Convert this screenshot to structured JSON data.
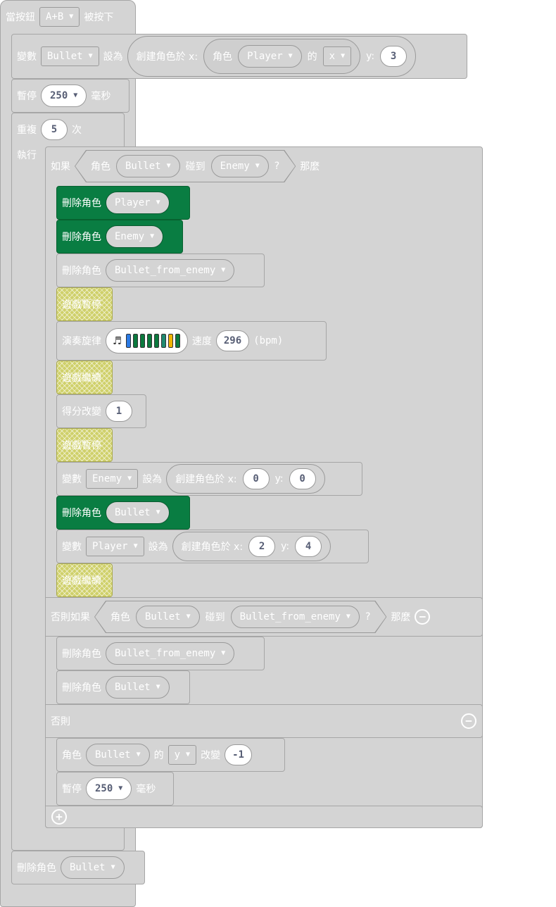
{
  "colors": {
    "block": "#d4d4d4",
    "sprite_green": "#097d42",
    "pause_yellow": "#cfd06a",
    "number_text": "#575e75"
  },
  "icons": {
    "dropdown": "caret-down-icon",
    "remove": "minus-circle-icon",
    "add": "plus-circle-icon",
    "note": "music-note-icon"
  },
  "hat": {
    "label": "當按鈕",
    "button": "A+B",
    "suffix": "被按下"
  },
  "set_bullet": {
    "label": "變數",
    "var": "Bullet",
    "set": "設為",
    "create": "創建角色於 x:",
    "sprite": "角色",
    "sprite_var": "Player",
    "of": "的",
    "prop": "x",
    "y_label": "y:",
    "y_val": "3"
  },
  "pause1": {
    "label": "暫停",
    "value": "250",
    "unit": "毫秒"
  },
  "repeat": {
    "label": "重複",
    "count": "5",
    "unit": "次",
    "do": "執行"
  },
  "if1": {
    "label": "如果",
    "sprite": "角色",
    "a": "Bullet",
    "touch": "碰到",
    "b": "Enemy",
    "q": "?",
    "then": "那麼"
  },
  "del_player": {
    "label": "刪除角色",
    "target": "Player"
  },
  "del_enemy": {
    "label": "刪除角色",
    "target": "Enemy"
  },
  "del_bfe": {
    "label": "刪除角色",
    "target": "Bullet_from_enemy"
  },
  "game_pause_1": {
    "label": "遊戲暫停"
  },
  "melody": {
    "label": "演奏旋律",
    "speed": "速度",
    "bpm": "296",
    "unit": "(bpm)",
    "bars": [
      "#2c7be5",
      "#0b7a3e",
      "#0b7a3e",
      "#0b7a3e",
      "#0b7a3e",
      "#1f8a70",
      "#f0b400",
      "#0b7a3e"
    ]
  },
  "game_resume_1": {
    "label": "遊戲繼續"
  },
  "score": {
    "label": "得分改變",
    "value": "1"
  },
  "game_pause_2": {
    "label": "遊戲暫停"
  },
  "set_enemy": {
    "label": "變數",
    "var": "Enemy",
    "set": "設為",
    "create": "創建角色於 x:",
    "x": "0",
    "y_label": "y:",
    "y": "0"
  },
  "del_bullet_g": {
    "label": "刪除角色",
    "target": "Bullet"
  },
  "set_player": {
    "label": "變數",
    "var": "Player",
    "set": "設為",
    "create": "創建角色於 x:",
    "x": "2",
    "y_label": "y:",
    "y": "4"
  },
  "game_resume_2": {
    "label": "遊戲繼續"
  },
  "elseif": {
    "label": "否則如果",
    "sprite": "角色",
    "a": "Bullet",
    "touch": "碰到",
    "b": "Bullet_from_enemy",
    "q": "?",
    "then": "那麼"
  },
  "del_bfe2": {
    "label": "刪除角色",
    "target": "Bullet_from_enemy"
  },
  "del_bullet2": {
    "label": "刪除角色",
    "target": "Bullet"
  },
  "else": {
    "label": "否則"
  },
  "change_y": {
    "label": "角色",
    "target": "Bullet",
    "of": "的",
    "prop": "y",
    "change": "改變",
    "value": "-1"
  },
  "pause2": {
    "label": "暫停",
    "value": "250",
    "unit": "毫秒"
  },
  "final_delete": {
    "label": "刪除角色",
    "target": "Bullet"
  }
}
